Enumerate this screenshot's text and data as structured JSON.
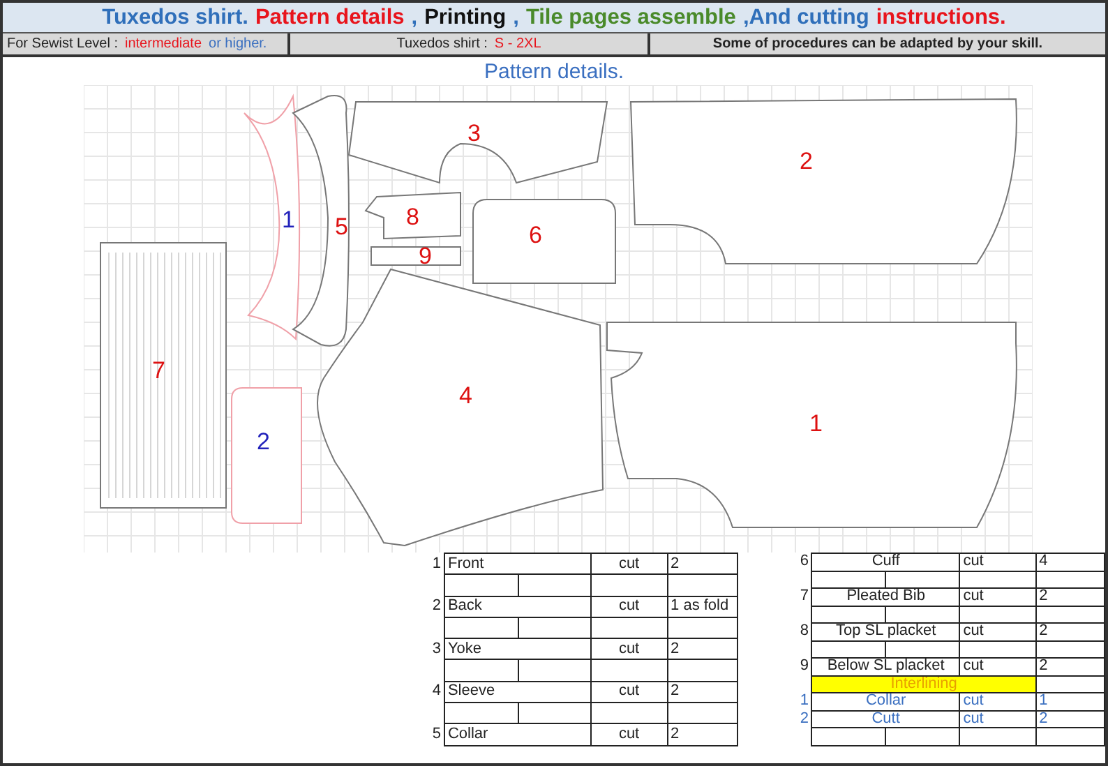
{
  "title": [
    {
      "text": "Tuxedos shirt.",
      "color": "#2f6fba"
    },
    {
      "text": "Pattern details",
      "color": "#e8141c"
    },
    {
      "text": ",",
      "color": "#2f6fba"
    },
    {
      "text": "Printing",
      "color": "#111111"
    },
    {
      "text": ",",
      "color": "#2f6fba"
    },
    {
      "text": "Tile pages assemble",
      "color": "#4a8a2a"
    },
    {
      "text": ",And cutting",
      "color": "#2f6fba"
    },
    {
      "text": "instructions.",
      "color": "#e8141c"
    }
  ],
  "info_bar": {
    "level_label": "For Sewist Level :",
    "level": "intermediate",
    "level_suffix": "or higher.",
    "size_label": "Tuxedos shirt :",
    "size": "S  - 2XL",
    "note": "Some of procedures  can be adapted by your skill."
  },
  "heading": "Pattern details.",
  "pieces": [
    {
      "number": "1",
      "color": "#2222bb",
      "kind": "collar"
    },
    {
      "number": "5",
      "color": "#dd1111",
      "kind": "collar_stand"
    },
    {
      "number": "3",
      "color": "#dd1111",
      "kind": "yoke"
    },
    {
      "number": "8",
      "color": "#dd1111",
      "kind": "placket_top"
    },
    {
      "number": "9",
      "color": "#dd1111",
      "kind": "placket_below"
    },
    {
      "number": "6",
      "color": "#dd1111",
      "kind": "cuff"
    },
    {
      "number": "7",
      "color": "#dd1111",
      "kind": "bib"
    },
    {
      "number": "2",
      "color": "#2222bb",
      "kind": "interlining_cuff"
    },
    {
      "number": "4",
      "color": "#dd1111",
      "kind": "sleeve"
    },
    {
      "number": "2",
      "color": "#dd1111",
      "kind": "back"
    },
    {
      "number": "1",
      "color": "#dd1111",
      "kind": "front"
    }
  ],
  "left_table": [
    {
      "no": "1",
      "name": "Front",
      "cut": "cut",
      "qty": "2"
    },
    {
      "no": "2",
      "name": "Back",
      "cut": "cut",
      "qty": "1 as fold"
    },
    {
      "no": "3",
      "name": "Yoke",
      "cut": "cut",
      "qty": "2"
    },
    {
      "no": "4",
      "name": "Sleeve",
      "cut": "cut",
      "qty": "2"
    },
    {
      "no": "5",
      "name": "Collar",
      "cut": "cut",
      "qty": "2"
    }
  ],
  "right_table": [
    {
      "no": "6",
      "name": "Cuff",
      "cut": "cut",
      "qty": "4"
    },
    {
      "no": "7",
      "name": "Pleated Bib",
      "cut": "cut",
      "qty": "2"
    },
    {
      "no": "8",
      "name": "Top SL placket",
      "cut": "cut",
      "qty": "2"
    },
    {
      "no": "9",
      "name": "Below SL placket",
      "cut": "cut",
      "qty": "2"
    }
  ],
  "interlining": {
    "title": "Interlining",
    "rows": [
      {
        "no": "1",
        "name": "Collar",
        "cut": "cut",
        "qty": "1"
      },
      {
        "no": "2",
        "name": "Cutt",
        "cut": "cut",
        "qty": "2"
      }
    ]
  }
}
